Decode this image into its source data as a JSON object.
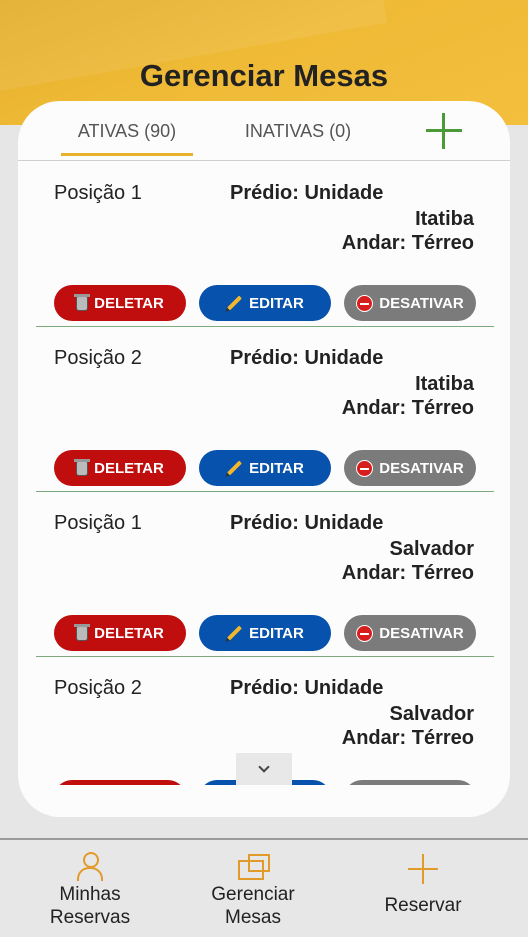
{
  "header": {
    "title": "Gerenciar Mesas"
  },
  "tabs": {
    "active_label": "ATIVAS (90)",
    "inactive_label": "INATIVAS (0)"
  },
  "items": [
    {
      "position": "Posição 1",
      "building": "Prédio: Unidade",
      "city": "Itatiba",
      "floor": "Andar: Térreo"
    },
    {
      "position": "Posição 2",
      "building": "Prédio: Unidade",
      "city": "Itatiba",
      "floor": "Andar: Térreo"
    },
    {
      "position": "Posição 1",
      "building": "Prédio: Unidade",
      "city": "Salvador",
      "floor": "Andar: Térreo"
    },
    {
      "position": "Posição 2",
      "building": "Prédio: Unidade",
      "city": "Salvador",
      "floor": "Andar: Térreo"
    }
  ],
  "actions": {
    "delete_label": "DELETAR",
    "edit_label": "EDITAR",
    "disable_label": "DESATIVAR"
  },
  "bottom_nav": {
    "reservations_label_1": "Minhas",
    "reservations_label_2": "Reservas",
    "manage_label_1": "Gerenciar",
    "manage_label_2": "Mesas",
    "reserve_label": "Reservar"
  },
  "colors": {
    "brand_yellow": "#efba36",
    "delete_red": "#c00d0d",
    "edit_blue": "#0652ac",
    "disable_gray": "#7b7b7b",
    "add_green": "#4a9a3a",
    "nav_orange": "#e29a2a"
  },
  "icons": [
    "add-icon",
    "trash-icon",
    "pencil-icon",
    "stop-icon",
    "chevron-down-icon",
    "user-icon",
    "desk-icon",
    "plus-icon"
  ]
}
